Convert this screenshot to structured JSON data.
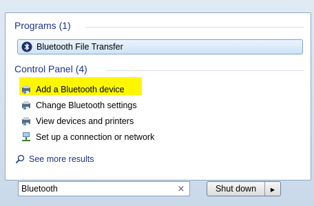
{
  "groups": {
    "programs_title": "Programs (1)",
    "control_panel_title": "Control Panel (4)"
  },
  "programs": [
    {
      "label": "Bluetooth File Transfer",
      "icon": "bluetooth-icon"
    }
  ],
  "control_panel": [
    {
      "label": "Add a Bluetooth device",
      "icon": "devices-printer-icon"
    },
    {
      "label": "Change Bluetooth settings",
      "icon": "devices-printer-icon"
    },
    {
      "label": "View devices and printers",
      "icon": "devices-printer-icon"
    },
    {
      "label": "Set up a connection or network",
      "icon": "network-icon"
    }
  ],
  "see_more": {
    "label": "See more results",
    "icon": "search-icon"
  },
  "search": {
    "value": "Bluetooth",
    "clear_glyph": "×"
  },
  "shutdown": {
    "label": "Shut down",
    "arrow_glyph": "▸"
  },
  "colors": {
    "highlight": "#fff700",
    "link": "#1e3287"
  }
}
